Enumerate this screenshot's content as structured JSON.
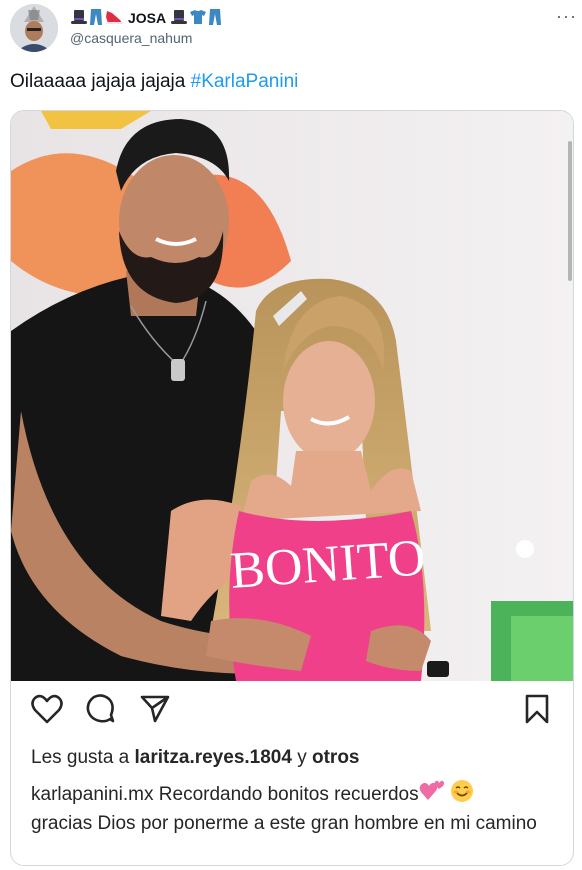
{
  "author": {
    "display_name": "JOSA",
    "handle": "@casquera_nahum",
    "name_icons_left": [
      "top-hat-icon",
      "jeans-icon",
      "sneaker-icon"
    ],
    "name_icons_right": [
      "top-hat-icon",
      "tshirt-icon",
      "jeans-icon"
    ]
  },
  "more_label": "···",
  "tweet": {
    "text": "Oilaaaaa jajaja jajaja ",
    "hashtag": "#KarlaPanini"
  },
  "post": {
    "image_shirt_text": "BONITO",
    "likes_prefix": "Les gusta a ",
    "likes_user": "laritza.reyes.1804",
    "likes_mid": " y ",
    "likes_others": "otros",
    "caption_user": "karlapanini.mx",
    "caption_line1": " Recordando bonitos recuerdos",
    "caption_line2": "gracias Dios por ponerme a este gran hombre en mi camino",
    "icons": [
      "heart-icon",
      "comment-icon",
      "share-icon",
      "bookmark-icon"
    ]
  },
  "colors": {
    "hashtag": "#1d9bf0",
    "shirt_pink": "#f0408a",
    "border": "#cfd9de"
  }
}
